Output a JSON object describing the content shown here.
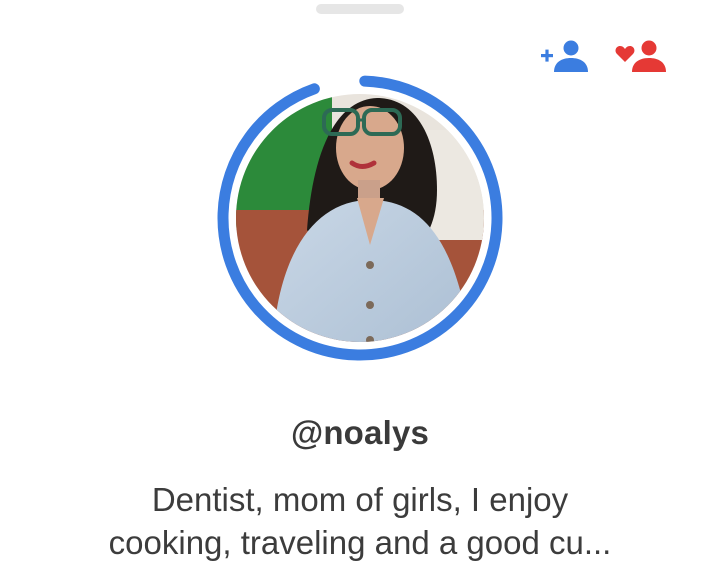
{
  "profile": {
    "username": "@noalys",
    "bio_line1": "Dentist, mom of girls, I enjoy",
    "bio_line2": "cooking, traveling and a good cu...",
    "story_progress": 0.94
  },
  "actions": {
    "add_friend_icon": "add-friend-icon",
    "match_icon": "heart-person-icon"
  },
  "colors": {
    "accent_blue": "#3b7de0",
    "accent_red": "#e53935",
    "text": "#3a3a3a"
  }
}
